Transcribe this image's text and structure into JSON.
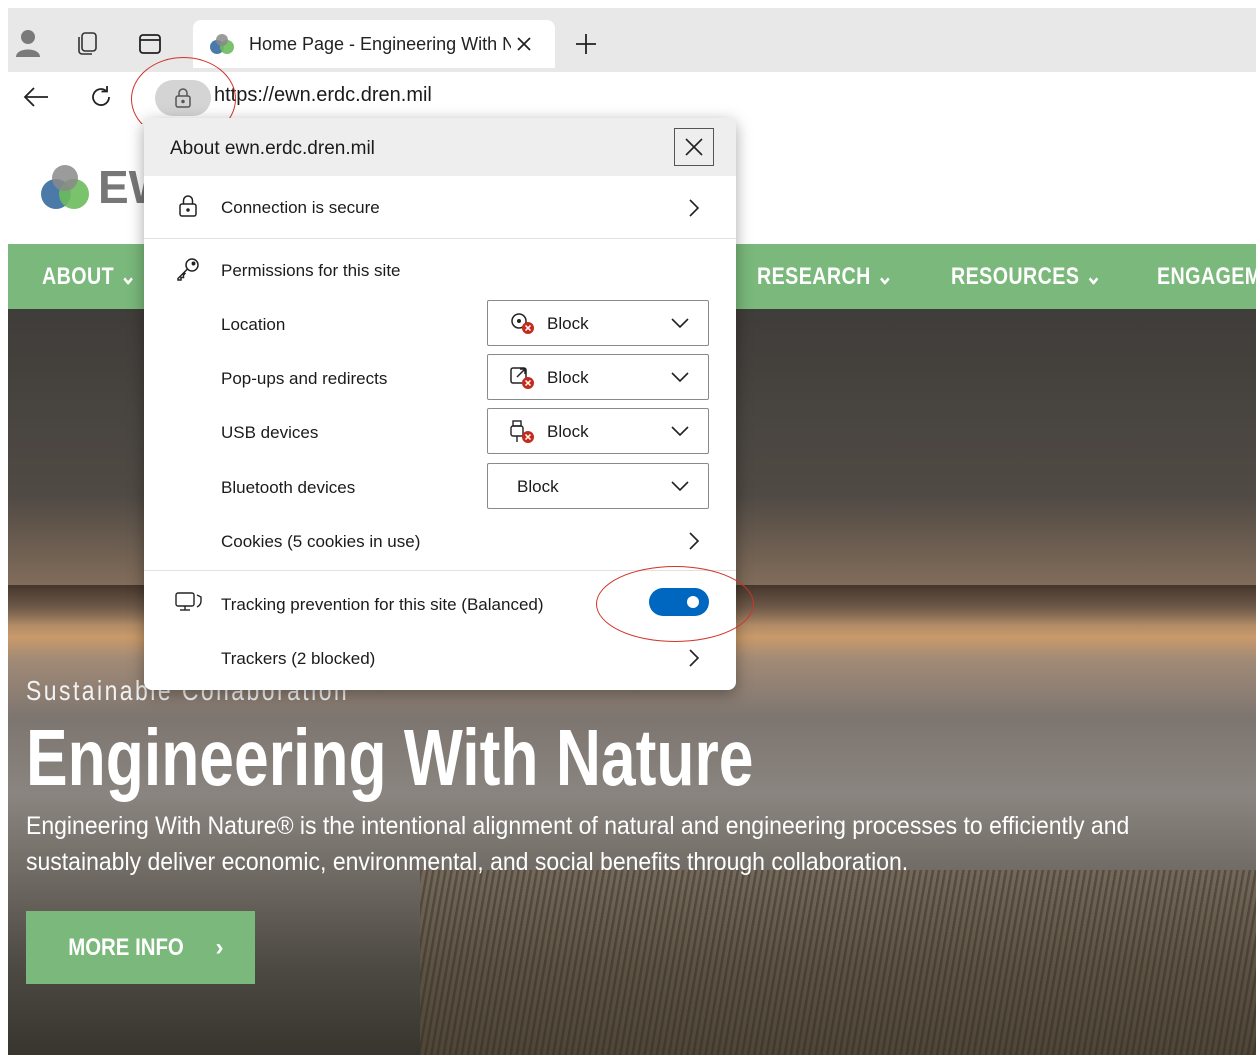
{
  "browser": {
    "tab_title": "Home Page - Engineering With N",
    "url": "https://ewn.erdc.dren.mil"
  },
  "site": {
    "logo_text": "EW",
    "nav": [
      "ABOUT",
      "RESEARCH",
      "RESOURCES",
      "ENGAGEM"
    ],
    "tagline": "Sustainable Collaboration",
    "headline": "Engineering With Nature",
    "description": "Engineering With Nature® is the intentional alignment of natural and engineering processes to efficiently and sustainably deliver economic, environmental, and social benefits through collaboration.",
    "more_button": "MORE INFO",
    "accent_color": "#7ab87b"
  },
  "popup": {
    "title": "About ewn.erdc.dren.mil",
    "connection": "Connection is secure",
    "permissions_header": "Permissions for this site",
    "permissions": [
      {
        "label": "Location",
        "value": "Block",
        "icon": "location-blocked-icon"
      },
      {
        "label": "Pop-ups and redirects",
        "value": "Block",
        "icon": "popup-blocked-icon"
      },
      {
        "label": "USB devices",
        "value": "Block",
        "icon": "usb-blocked-icon"
      },
      {
        "label": "Bluetooth devices",
        "value": "Block",
        "icon": ""
      }
    ],
    "cookies": "Cookies (5 cookies in use)",
    "tracking": "Tracking prevention for this site (Balanced)",
    "tracking_enabled": true,
    "trackers": "Trackers (2 blocked)"
  }
}
